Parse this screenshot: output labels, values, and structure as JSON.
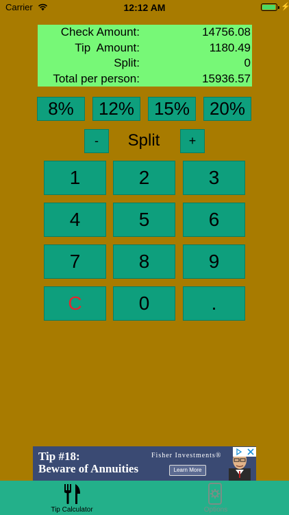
{
  "status_bar": {
    "carrier": "Carrier",
    "time": "12:12 AM"
  },
  "summary": {
    "check_amount": {
      "label": "Check Amount:",
      "value": "14756.08"
    },
    "tip_amount": {
      "label": "Tip  Amount:",
      "value": "1180.49"
    },
    "split": {
      "label": "Split:",
      "value": "0"
    },
    "total_per_person": {
      "label": "Total per person:",
      "value": "15936.57"
    }
  },
  "tip_buttons": [
    "8%",
    "12%",
    "15%",
    "20%"
  ],
  "split_controls": {
    "minus": "-",
    "label": "Split",
    "plus": "+"
  },
  "keypad": [
    "1",
    "2",
    "3",
    "4",
    "5",
    "6",
    "7",
    "8",
    "9",
    "C",
    "0",
    "."
  ],
  "ad": {
    "title_line1": "Tip #18:",
    "title_line2": "Beware of Annuities",
    "brand": "Fisher Investments®",
    "cta": "Learn More"
  },
  "tabbar": {
    "tabs": [
      {
        "label": "Tip Calculator",
        "icon": "fork-knife-icon",
        "active": true
      },
      {
        "label": "Options",
        "icon": "phone-gear-icon",
        "active": false
      }
    ]
  },
  "colors": {
    "background": "#a87b00",
    "summary_bg": "#77f877",
    "button": "#0e9f7d",
    "tabbar": "#23b08a",
    "clear_key": "#e3262f"
  }
}
